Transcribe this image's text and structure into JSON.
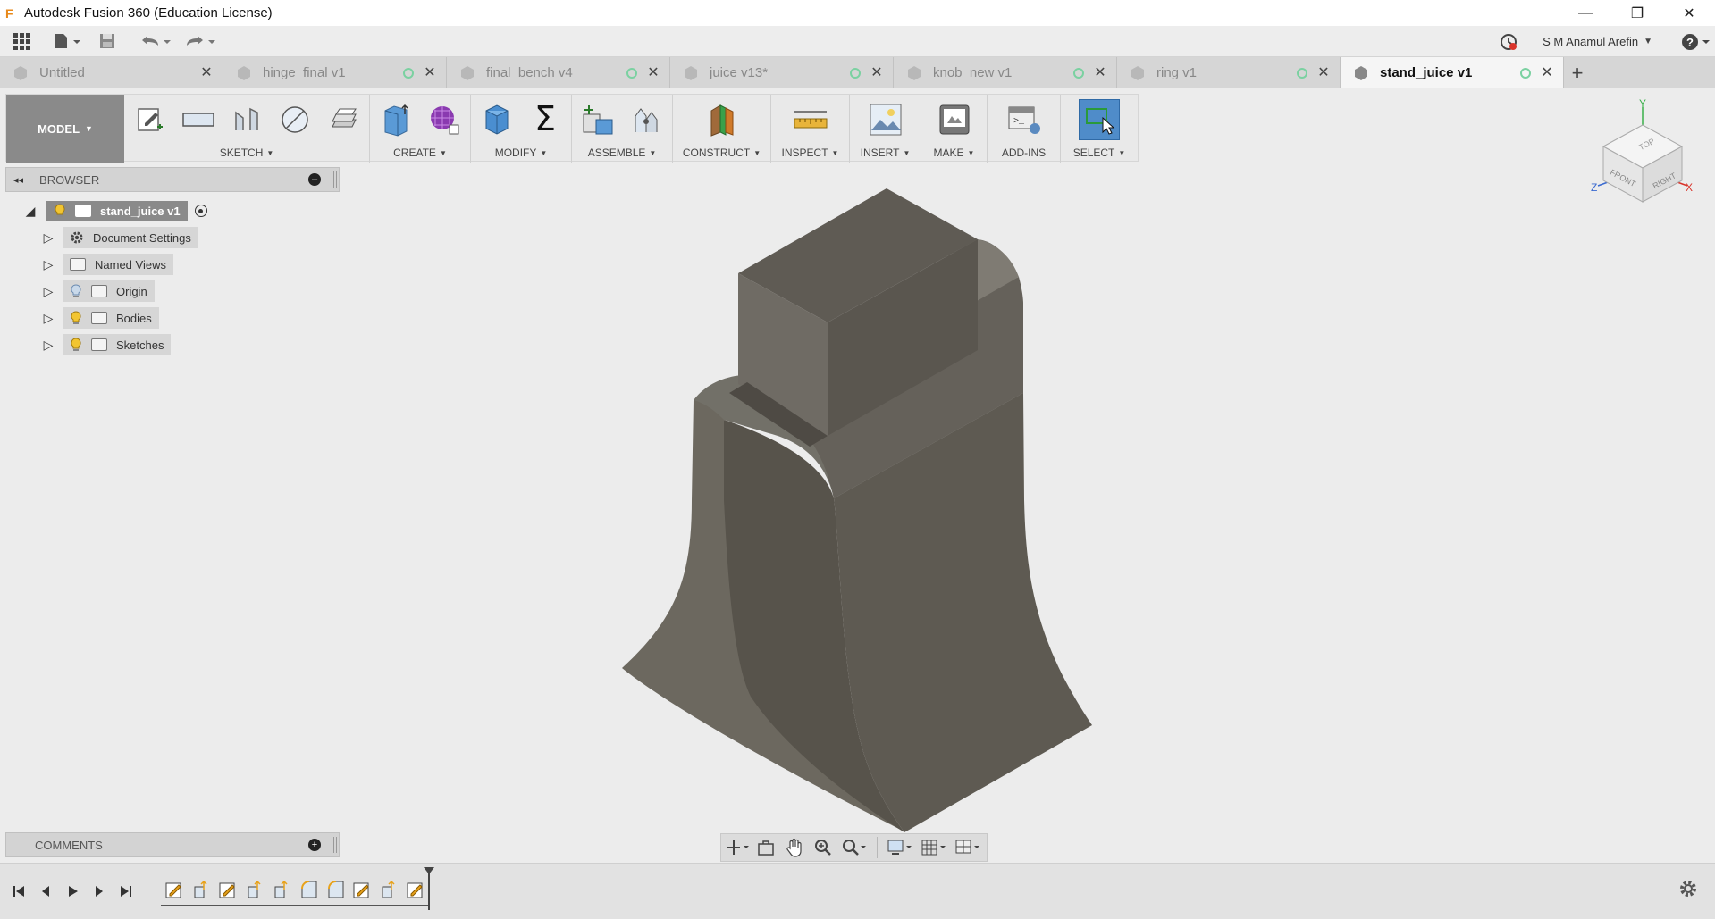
{
  "window": {
    "title": "Autodesk Fusion 360 (Education License)",
    "app_logo": "F",
    "controls": {
      "minimize": "—",
      "restore": "❐",
      "close": "✕"
    }
  },
  "quick_access": {
    "user_name": "S M Anamul Arefin",
    "icons": [
      "grid-menu-icon",
      "file-icon",
      "save-icon",
      "undo-icon",
      "redo-icon",
      "job-status-icon",
      "help-icon"
    ]
  },
  "tabs": [
    {
      "label": "Untitled",
      "active": false,
      "dot": false
    },
    {
      "label": "hinge_final v1",
      "active": false,
      "dot": true
    },
    {
      "label": "final_bench v4",
      "active": false,
      "dot": true
    },
    {
      "label": "juice v13*",
      "active": false,
      "dot": true
    },
    {
      "label": "knob_new v1",
      "active": false,
      "dot": true
    },
    {
      "label": "ring v1",
      "active": false,
      "dot": true
    },
    {
      "label": "stand_juice v1",
      "active": true,
      "dot": true
    }
  ],
  "tab_add": "+",
  "ribbon": {
    "workspace": "MODEL",
    "groups": [
      {
        "label": "SKETCH",
        "icons": [
          "create-sketch-icon",
          "rectangle-icon",
          "line-icon",
          "circle-icon",
          "project-icon"
        ]
      },
      {
        "label": "CREATE",
        "icons": [
          "extrude-icon",
          "form-icon"
        ]
      },
      {
        "label": "MODIFY",
        "icons": [
          "press-pull-icon",
          "sigma-icon"
        ]
      },
      {
        "label": "ASSEMBLE",
        "icons": [
          "new-component-icon",
          "joint-icon"
        ]
      },
      {
        "label": "CONSTRUCT",
        "icons": [
          "offset-plane-icon"
        ]
      },
      {
        "label": "INSPECT",
        "icons": [
          "measure-icon"
        ]
      },
      {
        "label": "INSERT",
        "icons": [
          "insert-image-icon"
        ]
      },
      {
        "label": "MAKE",
        "icons": [
          "print-3d-icon"
        ]
      },
      {
        "label": "ADD-INS",
        "icons": [
          "scripts-icon"
        ]
      },
      {
        "label": "SELECT",
        "icons": [
          "select-icon"
        ]
      }
    ]
  },
  "browser": {
    "title": "BROWSER",
    "collapse_symbol": "◂◂",
    "root": "stand_juice v1",
    "items": [
      {
        "label": "Document Settings",
        "icon": "gear-icon",
        "bulb": false
      },
      {
        "label": "Named Views",
        "icon": "folder-icon",
        "bulb": false
      },
      {
        "label": "Origin",
        "icon": "folder-icon",
        "bulb": true,
        "bulb_color": "#9ab8d8"
      },
      {
        "label": "Bodies",
        "icon": "folder-icon",
        "bulb": true,
        "bulb_color": "#f2c531"
      },
      {
        "label": "Sketches",
        "icon": "folder-icon",
        "bulb": true,
        "bulb_color": "#f2c531"
      }
    ]
  },
  "comments": {
    "title": "COMMENTS"
  },
  "viewcube": {
    "faces": {
      "top": "TOP",
      "front": "FRONT",
      "right": "RIGHT"
    },
    "axes": {
      "y": "Y",
      "x": "X",
      "z": "Z"
    }
  },
  "colors": {
    "model_dark": "#5a564f",
    "model_mid": "#6e6a63",
    "model_light": "#7a766e",
    "accent_blue": "#4f8cc9"
  }
}
